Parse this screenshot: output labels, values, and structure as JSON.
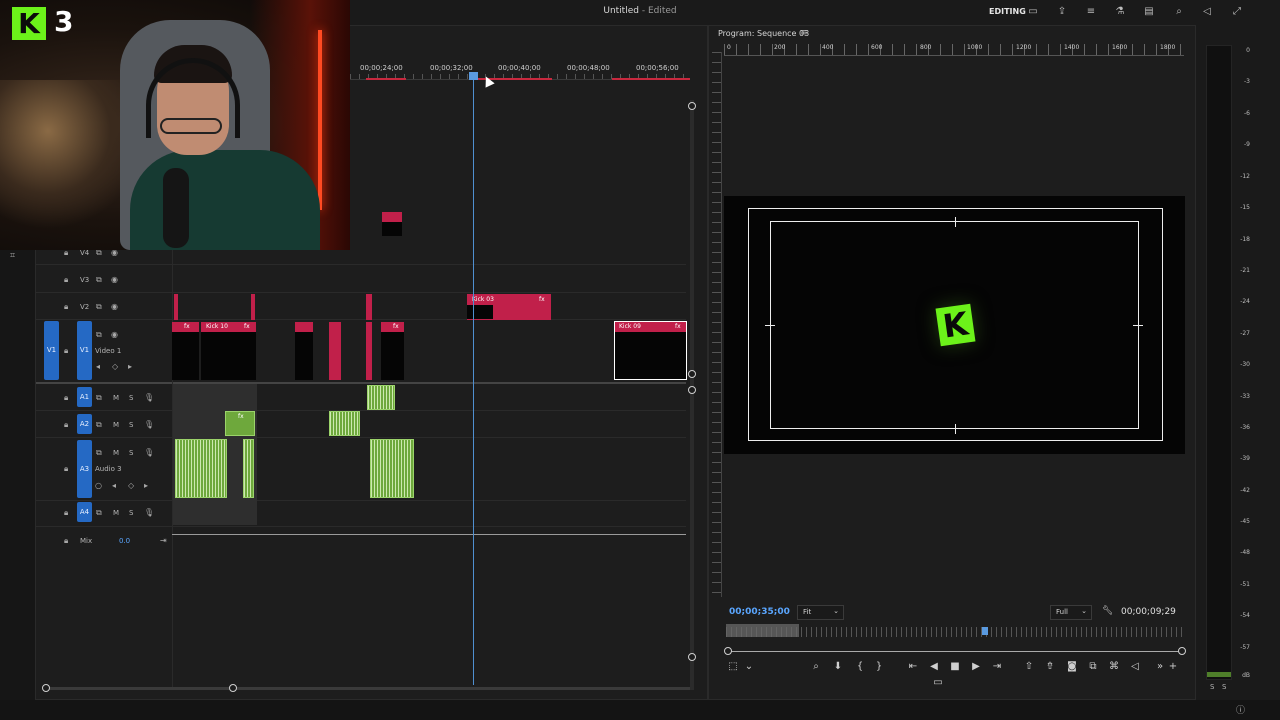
{
  "app": {
    "doc_title": "Untitled",
    "doc_status": "- Edited",
    "workspace": "EDITING"
  },
  "overlay": {
    "logo_letter": "K",
    "episode_number": "3"
  },
  "timeline": {
    "ruler_labels": [
      "00;00;24;00",
      "00;00;32;00",
      "00;00;40;00",
      "00;00;48;00",
      "00;00;56;00"
    ],
    "tracks": {
      "v4": "V4",
      "v3": "V3",
      "v2": "V2",
      "v1_source": "V1",
      "v1": "V1",
      "video1_name": "Video 1",
      "a1": "A1",
      "a2": "A2",
      "a3": "A3",
      "audio3_name": "Audio 3",
      "a4": "A4",
      "mix": "Mix",
      "mix_value": "0.0",
      "mute": "M",
      "solo": "S"
    },
    "clips": {
      "kick10": "Kick 10",
      "kick03": "Kick 03",
      "kick09": "Kick 09",
      "fx": "fx"
    }
  },
  "program": {
    "title": "Program: Sequence 03",
    "ruler_labels": [
      "0",
      "200",
      "400",
      "600",
      "800",
      "1000",
      "1200",
      "1400",
      "1600",
      "1800"
    ],
    "center_logo": "K",
    "timecode_current": "00;00;35;00",
    "zoom_select": "Fit",
    "quality_select": "Full",
    "timecode_duration": "00;00;09;29"
  },
  "meter": {
    "labels": [
      "0",
      "-3",
      "-6",
      "-9",
      "-12",
      "-15",
      "-18",
      "-21",
      "-24",
      "-27",
      "-30",
      "-33",
      "-36",
      "-39",
      "-42",
      "-45",
      "-48",
      "-51",
      "-54",
      "-57",
      "dB"
    ],
    "solo_left": "S",
    "solo_right": "S"
  },
  "colors": {
    "accent_blue": "#2569c4",
    "video_clip": "#c1204a",
    "audio_clip": "#6ea83c",
    "logo_green": "#6cf21a",
    "playhead": "#4f8fd0"
  }
}
